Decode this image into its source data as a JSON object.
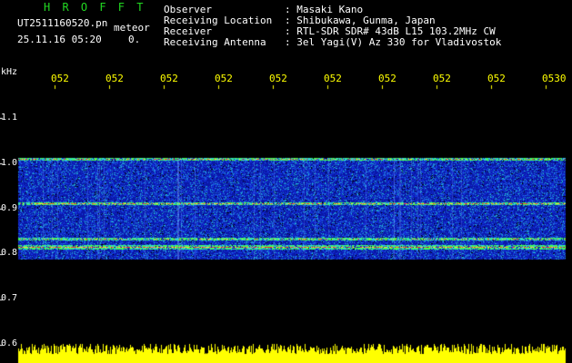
{
  "header": {
    "brand": "H R O F F T",
    "filename": "UT2511160520.pn",
    "datetime": "25.11.16 05:20",
    "mode": "meteor",
    "mode_value": "0."
  },
  "info": {
    "labels": [
      "Observer",
      "Receiving Location",
      "Receiver",
      "Receiving Antenna"
    ],
    "values": [
      ": Masaki Kano",
      ": Shibukawa, Gunma, Japan",
      ": RTL-SDR SDR# 43dB L15 103.2MHz CW",
      ": 3el Yagi(V) Az 330 for Vladivostok"
    ]
  },
  "axis": {
    "y_unit": "kHz",
    "y_ticks": [
      "1.1",
      "1.0",
      "0.9",
      "0.8",
      "0.7",
      "0.6"
    ],
    "time_ticks": [
      "052",
      "052",
      "052",
      "052",
      "052",
      "052",
      "052",
      "052",
      "052",
      "0530"
    ]
  },
  "colors": {
    "background": "#000000",
    "noise": "#0a1fc8",
    "echo_red": "#ff2020",
    "echo_green": "#3cff3c",
    "baseline": "#ffff00",
    "brand": "#22d822"
  }
}
